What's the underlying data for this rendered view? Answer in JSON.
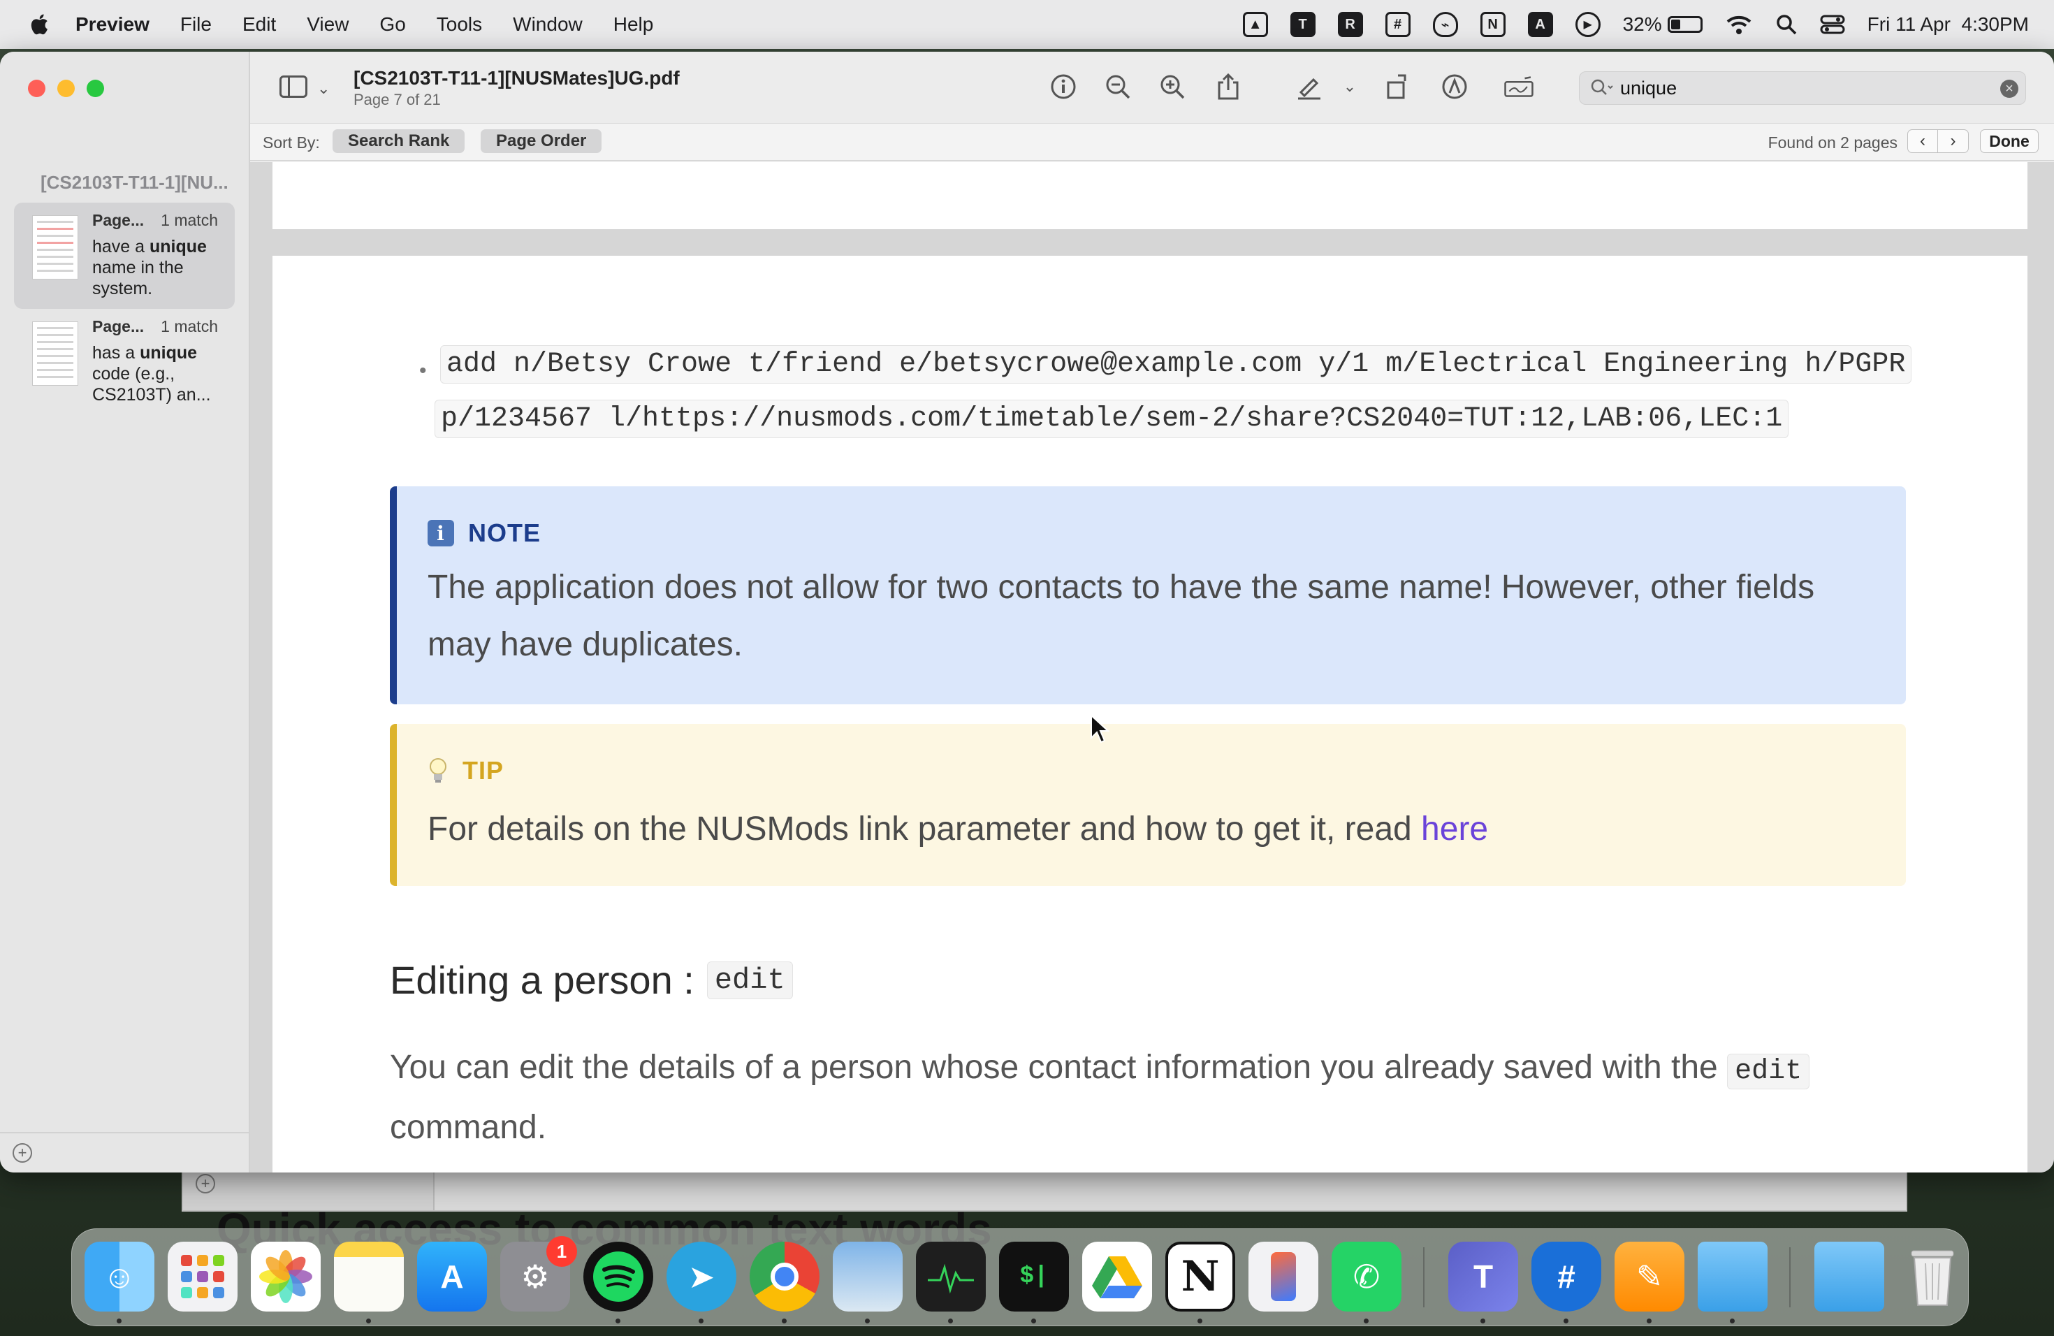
{
  "menubar": {
    "items": [
      "Preview",
      "File",
      "Edit",
      "View",
      "Go",
      "Tools",
      "Window",
      "Help"
    ],
    "battery_percent": "32%",
    "battery_level": 0.32,
    "datetime": "Fri 11 Apr  4:30PM",
    "status_icons": [
      "drive-icon",
      "teams-icon",
      "r-app-icon",
      "grid-app-icon",
      "vpn-shield-icon",
      "notion-icon",
      "text-a-icon",
      "play-icon"
    ]
  },
  "window": {
    "title": "[CS2103T-T11-1][NUSMates]UG.pdf",
    "subtitle": "Page 7 of 21",
    "toolbar_icons": [
      "info-icon",
      "zoom-out-icon",
      "zoom-in-icon",
      "share-icon",
      "markup-pen-icon",
      "rotate-icon",
      "highlight-icon",
      "signature-icon"
    ],
    "search_value": "unique"
  },
  "findbar": {
    "sort_by": "Sort By:",
    "search_rank": "Search Rank",
    "page_order": "Page Order",
    "found": "Found on 2 pages",
    "prev": "‹",
    "next": "›",
    "done": "Done"
  },
  "sidebar": {
    "doc_title": "[CS2103T-T11-1][NU...",
    "results": [
      {
        "page": "Page...",
        "count": "1 match",
        "pre": "have a ",
        "match": "unique",
        "post": " name in the system."
      },
      {
        "page": "Page...",
        "count": "1 match",
        "pre": "has a ",
        "match": "unique",
        "post": " code (e.g., CS2103T) an..."
      }
    ]
  },
  "doc": {
    "bullet": "•",
    "code_line1": "add n/Betsy Crowe t/friend e/betsycrowe@example.com y/1 m/Electrical Engineering h/PGPR",
    "code_line2": "p/1234567 l/https://nusmods.com/timetable/sem-2/share?CS2040=TUT:12,LAB:06,LEC:1",
    "note_label": "NOTE",
    "note_text": "The application does not allow for two contacts to have the same name! However, other fields may have duplicates.",
    "tip_label": "TIP",
    "tip_text": "For details on the NUSMods link parameter and how to get it, read ",
    "tip_link": "here",
    "heading": "Editing a person :",
    "heading_code": "edit",
    "para_pre": "You can edit the details of a person whose contact information you already saved with the ",
    "para_code": "edit",
    "para_post": " command."
  },
  "behind": {
    "text": "Quick access to common text words"
  },
  "dock": {
    "apps": [
      "Finder",
      "Launchpad",
      "Photos",
      "Notes",
      "App Store",
      "System Settings",
      "Spotify",
      "Telegram",
      "Chrome",
      "Preview",
      "Activity Monitor",
      "Terminal",
      "Google Drive",
      "Notion",
      "iPhone Mirroring",
      "WhatsApp",
      "Microsoft Teams",
      "Network Shield",
      "Pages",
      "Folder",
      "Downloads Folder",
      "Trash"
    ],
    "settings_badge": "1"
  }
}
